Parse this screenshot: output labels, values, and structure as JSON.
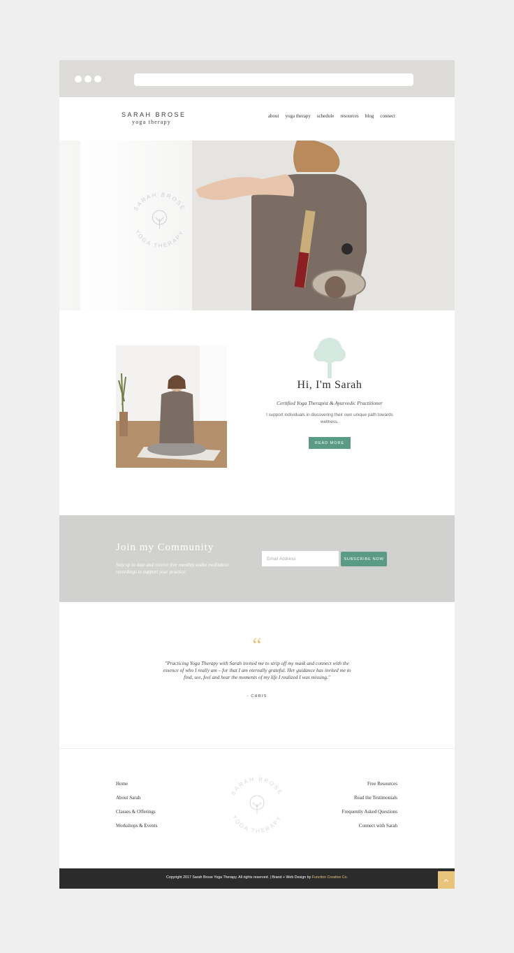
{
  "site": {
    "logo_name": "SARAH BROSE",
    "logo_sub": "yoga therapy",
    "nav": [
      "about",
      "yoga therapy",
      "schedule",
      "resources",
      "blog",
      "connect"
    ]
  },
  "hero": {
    "seal_name": "SARAH BROSE",
    "seal_sub": "YOGA THERAPY"
  },
  "about": {
    "title": "Hi, I'm Sarah",
    "subtitle": "Certified Yoga Therapist & Ayurvedic Practitioner",
    "description": "I support individuals in discovering their own unique path towards wellness.",
    "button": "READ MORE"
  },
  "community": {
    "title": "Join my Community",
    "text": "Stay up to date and receive free monthly audio meditation recordings to support your practice.",
    "email_placeholder": "Email Address",
    "button": "SUBSCRIBE NOW"
  },
  "testimonial": {
    "quote_mark": "“",
    "text": "\"Practicing Yoga Therapy with Sarah invited me to strip off my mask and connect with the essence of who I really am – for that I am eternally grateful. Her guidance has invited me to find, see, feel and hear the moments of my life I realized I was missing.\"",
    "author": "- CHRIS"
  },
  "footer": {
    "left_links": [
      "Home",
      "About Sarah",
      "Classes & Offerings",
      "Workshops & Events"
    ],
    "right_links": [
      "Free Resources",
      "Read the Testimonials",
      "Frequently Asked Questions",
      "Connect with Sarah"
    ],
    "copyright": "Copyright 2017 Sarah Brose Yoga Therapy. All rights reserved. | Brand + Web Design by",
    "designer": "Function Creative Co.",
    "back_to_top_icon": "chevron-up-icon"
  },
  "colors": {
    "accent_green": "#5b9a84",
    "accent_gold": "#e8c47a",
    "band_gray": "#d1d1cf",
    "footer_dark": "#2b2b2b"
  }
}
